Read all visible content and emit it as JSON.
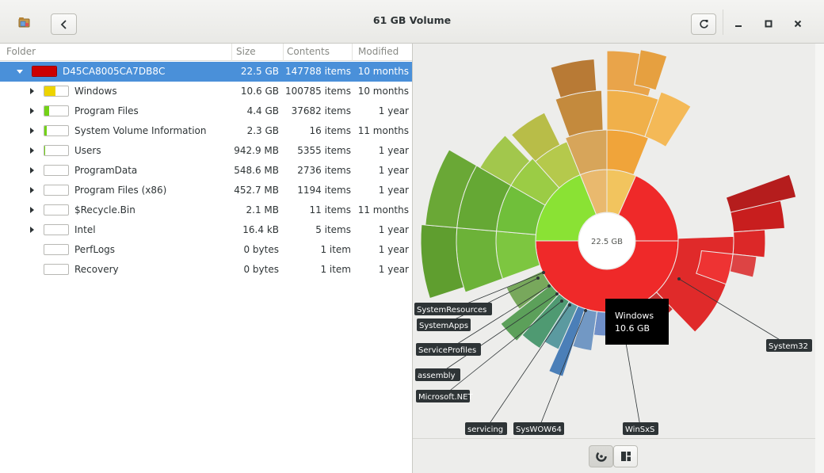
{
  "window": {
    "title": "61 GB Volume"
  },
  "header": {
    "app_icon": "disk-usage-app-icon",
    "back_icon": "chevron-left-icon",
    "reload_icon": "reload-icon",
    "minimize_icon": "minimize-icon",
    "maximize_icon": "maximize-icon",
    "close_icon": "close-icon"
  },
  "columns": {
    "folder": "Folder",
    "size": "Size",
    "contents": "Contents",
    "modified": "Modified"
  },
  "rows": [
    {
      "name": "D45CA8005CA7DB8C",
      "size": "22.5 GB",
      "contents": "147788 items",
      "modified": "10 months",
      "fill": 1.0,
      "color": "#cc0000",
      "expander": "expanded"
    },
    {
      "name": "Windows",
      "size": "10.6 GB",
      "contents": "100785 items",
      "modified": "10 months",
      "fill": 0.47,
      "color": "#edd400",
      "expander": "collapsed"
    },
    {
      "name": "Program Files",
      "size": "4.4 GB",
      "contents": "37682 items",
      "modified": "1 year",
      "fill": 0.2,
      "color": "#73d216",
      "expander": "collapsed"
    },
    {
      "name": "System Volume Information",
      "size": "2.3 GB",
      "contents": "16 items",
      "modified": "11 months",
      "fill": 0.1,
      "color": "#73d216",
      "expander": "collapsed"
    },
    {
      "name": "Users",
      "size": "942.9 MB",
      "contents": "5355 items",
      "modified": "1 year",
      "fill": 0.04,
      "color": "#73d216",
      "expander": "collapsed"
    },
    {
      "name": "ProgramData",
      "size": "548.6 MB",
      "contents": "2736 items",
      "modified": "1 year",
      "fill": 0.0,
      "color": "#73d216",
      "expander": "collapsed"
    },
    {
      "name": "Program Files (x86)",
      "size": "452.7 MB",
      "contents": "1194 items",
      "modified": "1 year",
      "fill": 0.0,
      "color": "#73d216",
      "expander": "collapsed"
    },
    {
      "name": "$Recycle.Bin",
      "size": "2.1 MB",
      "contents": "11 items",
      "modified": "11 months",
      "fill": 0.0,
      "color": "#73d216",
      "expander": "collapsed"
    },
    {
      "name": "Intel",
      "size": "16.4 kB",
      "contents": "5 items",
      "modified": "1 year",
      "fill": 0.0,
      "color": "#73d216",
      "expander": "collapsed"
    },
    {
      "name": "PerfLogs",
      "size": "0 bytes",
      "contents": "1 item",
      "modified": "1 year",
      "fill": 0.0,
      "color": "#73d216",
      "expander": "none"
    },
    {
      "name": "Recovery",
      "size": "0 bytes",
      "contents": "1 item",
      "modified": "1 year",
      "fill": 0.0,
      "color": "#73d216",
      "expander": "none"
    }
  ],
  "chart": {
    "center_label": "22.5 GB",
    "tooltip": {
      "name": "Windows",
      "size": "10.6 GB"
    },
    "labels": [
      "SystemResources",
      "SystemApps",
      "ServiceProfiles",
      "assembly",
      "Microsoft.NET",
      "servicing",
      "SysWOW64",
      "WinSxS",
      "System32"
    ]
  },
  "bottom": {
    "ring_chart_icon": "ring-chart-icon",
    "treemap_icon": "treemap-chart-icon"
  }
}
